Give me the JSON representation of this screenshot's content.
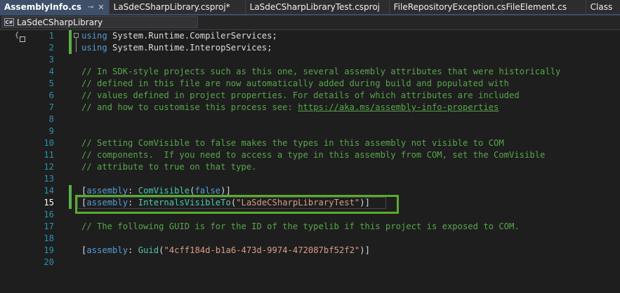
{
  "tabs": [
    {
      "label": "AssemblyInfo.cs",
      "active": true,
      "pin": "⊸",
      "close": "✕"
    },
    {
      "label": "LaSdeCSharpLibrary.csproj*"
    },
    {
      "label": "LaSdeCSharpLibraryTest.csproj"
    },
    {
      "label": "FileRepositoryException.cs"
    },
    {
      "label": "FileElement.cs"
    },
    {
      "label": "Class"
    }
  ],
  "navbar": {
    "project": "LaSdeCSharpLibrary",
    "icon_text": "C#"
  },
  "editor": {
    "current_line": "15",
    "lines": [
      {
        "num": "1"
      },
      {
        "num": "2"
      },
      {
        "num": "3"
      },
      {
        "num": "4"
      },
      {
        "num": "5"
      },
      {
        "num": "6"
      },
      {
        "num": "7"
      },
      {
        "num": "8"
      },
      {
        "num": "9"
      },
      {
        "num": "10"
      },
      {
        "num": "11"
      },
      {
        "num": "12"
      },
      {
        "num": "13"
      },
      {
        "num": "14"
      },
      {
        "num": "15"
      },
      {
        "num": "16"
      },
      {
        "num": "17"
      },
      {
        "num": "18"
      },
      {
        "num": "19"
      },
      {
        "num": "20"
      }
    ],
    "t": {
      "l1_kw": "using",
      "l1_rest": " System.Runtime.CompilerServices;",
      "l2_kw": "using",
      "l2_rest": " System.Runtime.InteropServices;",
      "l4": "// In SDK-style projects such as this one, several assembly attributes that were historically",
      "l5": "// defined in this file are now automatically added during build and populated with",
      "l6": "// values defined in project properties. For details of which attributes are included",
      "l7_pre": "// and how to customise this process see: ",
      "l7_link": "https://aka.ms/assembly-info-properties",
      "l10": "// Setting ComVisible to false makes the types in this assembly not visible to COM",
      "l11": "// components.  If you need to access a type in this assembly from COM, set the ComVisible",
      "l12": "// attribute to true on that type.",
      "l14_a": "[",
      "l14_kw": "assembly",
      "l14_c": ": ",
      "l14_typ": "ComVisible",
      "l14_p": "(",
      "l14_val": "false",
      "l14_end": ")]",
      "l15_a": "[",
      "l15_kw": "assembly",
      "l15_c": ": ",
      "l15_typ": "InternalsVisibleTo",
      "l15_p": "(",
      "l15_str": "\"LaSdeCSharpLibraryTest\"",
      "l15_end": ")]",
      "l17": "// The following GUID is for the ID of the typelib if this project is exposed to COM.",
      "l19_a": "[",
      "l19_kw": "assembly",
      "l19_c": ": ",
      "l19_typ": "Guid",
      "l19_p": "(",
      "l19_str": "\"4cff184d-b1a6-473d-9974-472087bf52f2\"",
      "l19_end": ")]"
    }
  },
  "colors": {
    "background": "#1e1e1e",
    "keyword": "#569cd6",
    "type": "#4ec9b0",
    "string": "#d69d85",
    "comment": "#57a64a",
    "line_number": "#2b91af",
    "highlight_box": "#5aab2e"
  }
}
